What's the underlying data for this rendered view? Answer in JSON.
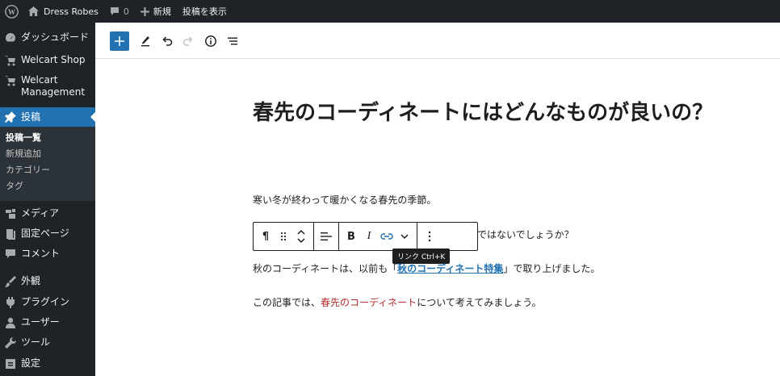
{
  "admin_bar": {
    "site_name": "Dress Robes",
    "comments_count": "0",
    "new_label": "新規",
    "view_post_label": "投稿を表示"
  },
  "sidebar": {
    "items": [
      {
        "label": "ダッシュボード",
        "icon": "dashboard-icon"
      },
      {
        "label": "Welcart Shop",
        "icon": "cart-icon"
      },
      {
        "label": "Welcart Management",
        "icon": "cart-icon"
      },
      {
        "label": "投稿",
        "icon": "pin-icon"
      },
      {
        "label": "メディア",
        "icon": "media-icon"
      },
      {
        "label": "固定ページ",
        "icon": "page-icon"
      },
      {
        "label": "コメント",
        "icon": "comment-icon"
      },
      {
        "label": "外観",
        "icon": "brush-icon"
      },
      {
        "label": "プラグイン",
        "icon": "plugin-icon"
      },
      {
        "label": "ユーザー",
        "icon": "user-icon"
      },
      {
        "label": "ツール",
        "icon": "wrench-icon"
      },
      {
        "label": "設定",
        "icon": "settings-icon"
      }
    ],
    "posts_submenu": [
      "投稿一覧",
      "新規追加",
      "カテゴリー",
      "タグ"
    ]
  },
  "editor": {
    "title": "春先のコーディネートにはどんなものが良いの？",
    "paragraph1": "寒い冬が終わって暖かくなる春先の季節。",
    "paragraph2_visible": "ではないでしょうか？",
    "paragraph3_before": "秋のコーディネートは、以前も「",
    "paragraph3_link": "秋のコーディネート特集",
    "paragraph3_after": "」で取り上げました。",
    "paragraph4_before": "この記事では、",
    "paragraph4_red": "春先のコーディネート",
    "paragraph4_after": "について考えてみましょう。",
    "tooltip": "リンク  Ctrl+K"
  },
  "colors": {
    "admin_dark": "#1d2327",
    "accent": "#2271b1",
    "red_text": "#b32d2e"
  }
}
